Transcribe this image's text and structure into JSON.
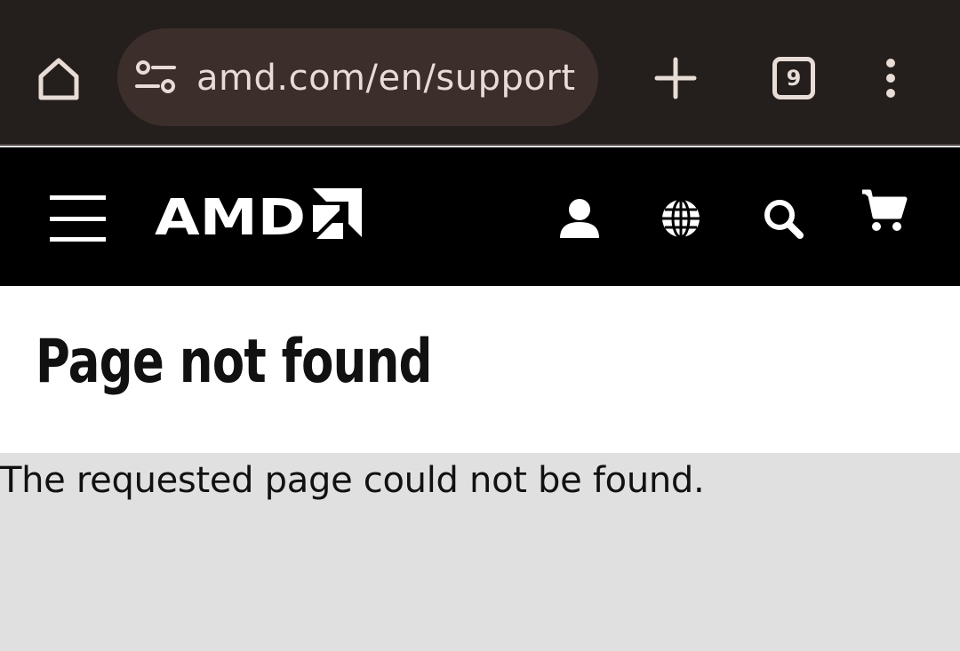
{
  "browser": {
    "url": "amd.com/en/support",
    "tab_count": "9"
  },
  "site": {
    "logo_text": "AMD",
    "icons": [
      "menu-icon",
      "user-icon",
      "globe-icon",
      "search-icon",
      "cart-icon"
    ]
  },
  "page": {
    "title": "Page not found",
    "message": "The requested page could not be found."
  },
  "colors": {
    "browser_chrome": "#241e1c",
    "urlbar": "#3c2f2b",
    "header": "#000000",
    "content_bg": "#e0e0e0"
  }
}
